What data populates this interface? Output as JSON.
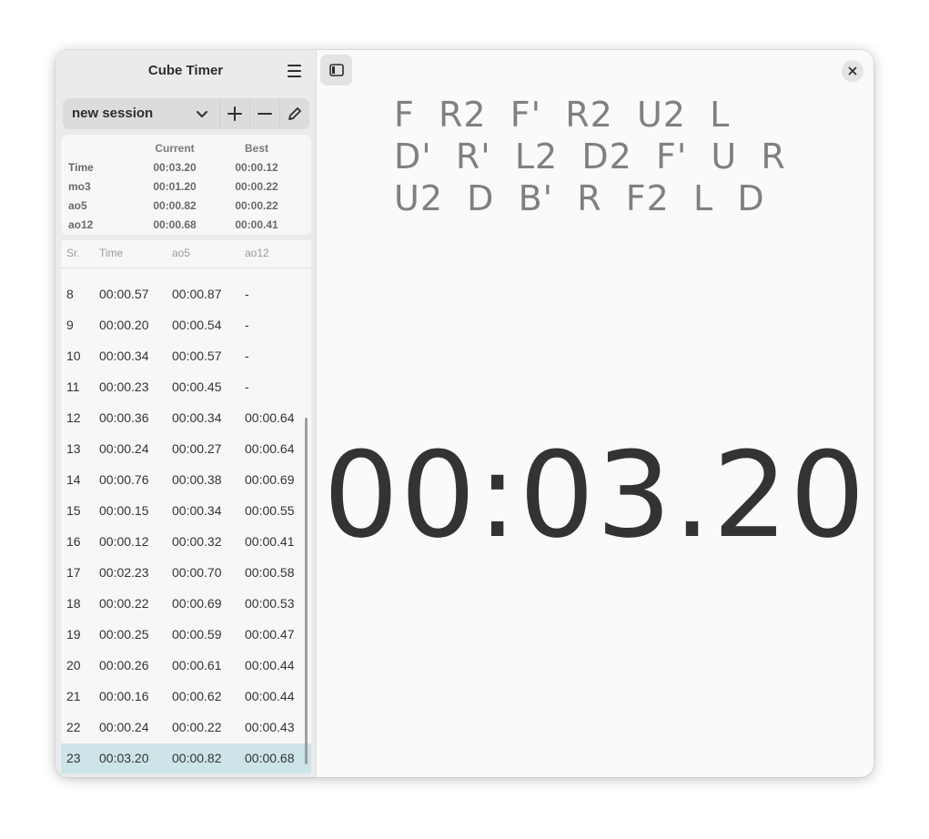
{
  "app": {
    "title": "Cube Timer"
  },
  "session": {
    "name": "new session"
  },
  "stats": {
    "headers": [
      "",
      "Current",
      "Best"
    ],
    "rows": [
      {
        "label": "Time",
        "current": "00:03.20",
        "best": "00:00.12"
      },
      {
        "label": "mo3",
        "current": "00:01.20",
        "best": "00:00.22"
      },
      {
        "label": "ao5",
        "current": "00:00.82",
        "best": "00:00.22"
      },
      {
        "label": "ao12",
        "current": "00:00.68",
        "best": "00:00.41"
      }
    ]
  },
  "solves": {
    "headers": [
      "Sr.",
      "Time",
      "ao5",
      "ao12"
    ],
    "rows": [
      {
        "sr": "8",
        "time": "00:00.57",
        "ao5": "00:00.87",
        "ao12": "-"
      },
      {
        "sr": "9",
        "time": "00:00.20",
        "ao5": "00:00.54",
        "ao12": "-"
      },
      {
        "sr": "10",
        "time": "00:00.34",
        "ao5": "00:00.57",
        "ao12": "-"
      },
      {
        "sr": "11",
        "time": "00:00.23",
        "ao5": "00:00.45",
        "ao12": "-"
      },
      {
        "sr": "12",
        "time": "00:00.36",
        "ao5": "00:00.34",
        "ao12": "00:00.64"
      },
      {
        "sr": "13",
        "time": "00:00.24",
        "ao5": "00:00.27",
        "ao12": "00:00.64"
      },
      {
        "sr": "14",
        "time": "00:00.76",
        "ao5": "00:00.38",
        "ao12": "00:00.69"
      },
      {
        "sr": "15",
        "time": "00:00.15",
        "ao5": "00:00.34",
        "ao12": "00:00.55"
      },
      {
        "sr": "16",
        "time": "00:00.12",
        "ao5": "00:00.32",
        "ao12": "00:00.41"
      },
      {
        "sr": "17",
        "time": "00:02.23",
        "ao5": "00:00.70",
        "ao12": "00:00.58"
      },
      {
        "sr": "18",
        "time": "00:00.22",
        "ao5": "00:00.69",
        "ao12": "00:00.53"
      },
      {
        "sr": "19",
        "time": "00:00.25",
        "ao5": "00:00.59",
        "ao12": "00:00.47"
      },
      {
        "sr": "20",
        "time": "00:00.26",
        "ao5": "00:00.61",
        "ao12": "00:00.44"
      },
      {
        "sr": "21",
        "time": "00:00.16",
        "ao5": "00:00.62",
        "ao12": "00:00.44"
      },
      {
        "sr": "22",
        "time": "00:00.24",
        "ao5": "00:00.22",
        "ao12": "00:00.43"
      },
      {
        "sr": "23",
        "time": "00:03.20",
        "ao5": "00:00.82",
        "ao12": "00:00.68"
      }
    ]
  },
  "scramble": {
    "lines": [
      "F  R2  F'  R2  U2  L",
      "D'  R'  L2  D2  F'  U  R",
      "U2  D  B'  R  F2  L  D"
    ]
  },
  "timer": {
    "display": "00:03.20"
  },
  "icons": {
    "menu": "hamburger-menu-icon",
    "dropdown": "chevron-down-icon",
    "add": "plus-icon",
    "remove": "minus-icon",
    "edit": "pencil-icon",
    "sidebar_toggle": "sidebar-toggle-icon",
    "close": "close-icon"
  },
  "colors": {
    "selected_row": "#cde4e8",
    "sidebar_bg": "#ebebed",
    "main_bg": "#fafafa"
  }
}
